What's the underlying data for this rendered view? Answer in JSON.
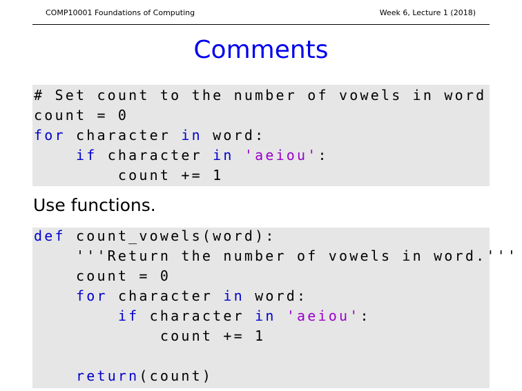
{
  "header": {
    "course": "COMP10001 Foundations of Computing",
    "lecture": "Week 6, Lecture 1 (2018)"
  },
  "title": "Comments",
  "colors": {
    "title": "#0000ee",
    "keyword": "#0000cc",
    "string": "#9900cc",
    "code_background": "#e6e6e6"
  },
  "code1": [
    [
      {
        "t": "# Set count to the number of vowels in word",
        "c": "plain"
      }
    ],
    [
      {
        "t": "count = 0",
        "c": "plain"
      }
    ],
    [
      {
        "t": "for",
        "c": "kw"
      },
      {
        "t": " character ",
        "c": "plain"
      },
      {
        "t": "in",
        "c": "kw"
      },
      {
        "t": " word:",
        "c": "plain"
      }
    ],
    [
      {
        "t": "    ",
        "c": "plain"
      },
      {
        "t": "if",
        "c": "kw"
      },
      {
        "t": " character ",
        "c": "plain"
      },
      {
        "t": "in",
        "c": "kw"
      },
      {
        "t": " ",
        "c": "plain"
      },
      {
        "t": "'aeiou'",
        "c": "str"
      },
      {
        "t": ":",
        "c": "plain"
      }
    ],
    [
      {
        "t": "        count += 1",
        "c": "plain"
      }
    ]
  ],
  "body_text": "Use functions.",
  "code2": [
    [
      {
        "t": "def",
        "c": "kw"
      },
      {
        "t": " count_vowels(word):",
        "c": "plain"
      }
    ],
    [
      {
        "t": "    '''Return the number of vowels in word.'''",
        "c": "plain"
      }
    ],
    [
      {
        "t": "    count = 0",
        "c": "plain"
      }
    ],
    [
      {
        "t": "    ",
        "c": "plain"
      },
      {
        "t": "for",
        "c": "kw"
      },
      {
        "t": " character ",
        "c": "plain"
      },
      {
        "t": "in",
        "c": "kw"
      },
      {
        "t": " word:",
        "c": "plain"
      }
    ],
    [
      {
        "t": "        ",
        "c": "plain"
      },
      {
        "t": "if",
        "c": "kw"
      },
      {
        "t": " character ",
        "c": "plain"
      },
      {
        "t": "in",
        "c": "kw"
      },
      {
        "t": " ",
        "c": "plain"
      },
      {
        "t": "'aeiou'",
        "c": "str"
      },
      {
        "t": ":",
        "c": "plain"
      }
    ],
    [
      {
        "t": "            count += 1",
        "c": "plain"
      }
    ],
    [
      {
        "t": "",
        "c": "plain"
      }
    ],
    [
      {
        "t": "    ",
        "c": "plain"
      },
      {
        "t": "return",
        "c": "kw"
      },
      {
        "t": "(count)",
        "c": "plain"
      }
    ]
  ]
}
